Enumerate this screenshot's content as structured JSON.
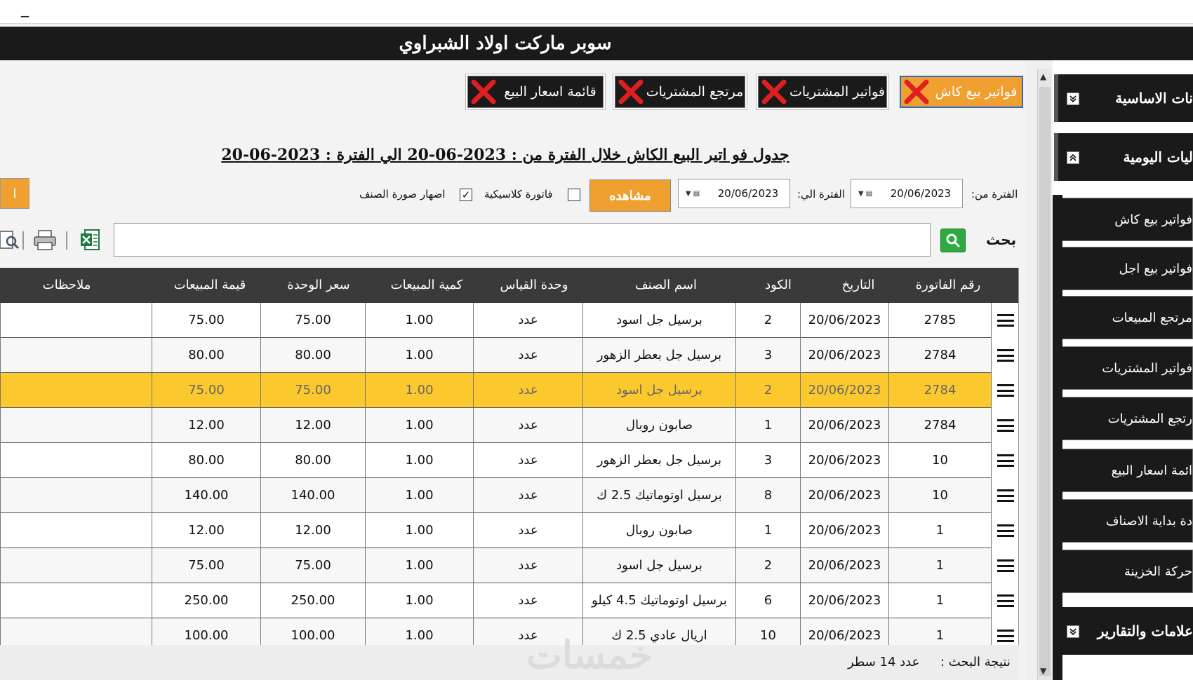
{
  "window": {
    "minimize_label": "_"
  },
  "app_title": "سوبر ماركت اولاد الشبراوي",
  "tabs": [
    {
      "label": "فواتير بيع كاش",
      "active": true
    },
    {
      "label": "فواتير المشتريات",
      "active": false
    },
    {
      "label": "مرتجع المشتريات",
      "active": false
    },
    {
      "label": "قائمة اسعار البيع",
      "active": false
    }
  ],
  "report": {
    "heading": "جدول فو اتير البيع الكاش خلال الفترة من : 2023-06-20 الي الفترة : 2023-06-20"
  },
  "filters": {
    "from_label": "الفترة من:",
    "from_value": "20/06/2023",
    "to_label": "الفترة الي:",
    "to_value": "20/06/2023",
    "view_button": "مشاهده",
    "classic_invoice_label": "فاتورة كلاسيكية",
    "classic_invoice_checked": false,
    "show_image_label": "اضهار صورة الصنف",
    "show_image_checked": true,
    "side_button": "ا"
  },
  "search": {
    "label": "بحث",
    "value": "",
    "placeholder": ""
  },
  "grid": {
    "headers": {
      "invoice_no": "رقم الفاتورة",
      "date": "التاريخ",
      "code": "الكود",
      "item_name": "اسم الصنف",
      "unit": "وحدة القياس",
      "qty": "كمية المبيعات",
      "unit_price": "سعر الوحدة",
      "sales_value": "قيمة المبيعات",
      "notes": "ملاحظات"
    },
    "rows": [
      {
        "invoice_no": "2785",
        "date": "20/06/2023",
        "code": "2",
        "item_name": "برسيل جل اسود",
        "unit": "عدد",
        "qty": "1.00",
        "unit_price": "75.00",
        "sales_value": "75.00",
        "notes": ""
      },
      {
        "invoice_no": "2784",
        "date": "20/06/2023",
        "code": "3",
        "item_name": "برسيل جل بعطر الزهور",
        "unit": "عدد",
        "qty": "1.00",
        "unit_price": "80.00",
        "sales_value": "80.00",
        "notes": ""
      },
      {
        "invoice_no": "2784",
        "date": "20/06/2023",
        "code": "2",
        "item_name": "برسيل جل اسود",
        "unit": "عدد",
        "qty": "1.00",
        "unit_price": "75.00",
        "sales_value": "75.00",
        "notes": "",
        "selected": true
      },
      {
        "invoice_no": "2784",
        "date": "20/06/2023",
        "code": "1",
        "item_name": "صابون روبال",
        "unit": "عدد",
        "qty": "1.00",
        "unit_price": "12.00",
        "sales_value": "12.00",
        "notes": ""
      },
      {
        "invoice_no": "10",
        "date": "20/06/2023",
        "code": "3",
        "item_name": "برسيل جل بعطر الزهور",
        "unit": "عدد",
        "qty": "1.00",
        "unit_price": "80.00",
        "sales_value": "80.00",
        "notes": ""
      },
      {
        "invoice_no": "10",
        "date": "20/06/2023",
        "code": "8",
        "item_name": "برسيل اوتوماتيك 2.5 ك",
        "unit": "عدد",
        "qty": "1.00",
        "unit_price": "140.00",
        "sales_value": "140.00",
        "notes": ""
      },
      {
        "invoice_no": "1",
        "date": "20/06/2023",
        "code": "1",
        "item_name": "صابون روبال",
        "unit": "عدد",
        "qty": "1.00",
        "unit_price": "12.00",
        "sales_value": "12.00",
        "notes": ""
      },
      {
        "invoice_no": "1",
        "date": "20/06/2023",
        "code": "2",
        "item_name": "برسيل جل اسود",
        "unit": "عدد",
        "qty": "1.00",
        "unit_price": "75.00",
        "sales_value": "75.00",
        "notes": ""
      },
      {
        "invoice_no": "1",
        "date": "20/06/2023",
        "code": "6",
        "item_name": "برسيل اوتوماتيك 4.5 كيلو",
        "unit": "عدد",
        "qty": "1.00",
        "unit_price": "250.00",
        "sales_value": "250.00",
        "notes": ""
      },
      {
        "invoice_no": "1",
        "date": "20/06/2023",
        "code": "10",
        "item_name": "اريال عادي 2.5 ك",
        "unit": "عدد",
        "qty": "1.00",
        "unit_price": "100.00",
        "sales_value": "100.00",
        "notes": ""
      }
    ]
  },
  "footer": {
    "result_label": "نتيجة البحث :",
    "result_value": "عدد 14 سطر",
    "watermark": "خمسات"
  },
  "sidebar": {
    "sections": [
      {
        "label": "نات الاساسية",
        "expanded": false
      },
      {
        "label": "ليات اليومية",
        "expanded": true
      },
      {
        "label": "علامات والتقارير",
        "expanded": false
      }
    ],
    "items": [
      {
        "label": "فواتير بيع كاش"
      },
      {
        "label": "فواتير بيع اجل"
      },
      {
        "label": "مرتجع المبيعات"
      },
      {
        "label": "فواتير المشتريات"
      },
      {
        "label": "رتجع المشتريات"
      },
      {
        "label": "ائمة اسعار البيع"
      },
      {
        "label": "دة بداية الاصناف"
      },
      {
        "label": "حركة الخزينة"
      }
    ]
  },
  "colors": {
    "accent_orange": "#f0a030",
    "selected_row": "#fbc92e",
    "title_bar": "#1a1a1a",
    "tab_border_active": "#2a6cc0",
    "close_red": "#e02020",
    "search_green": "#2eaa40"
  },
  "icons": [
    "close-x-icon",
    "calendar-icon",
    "dropdown-arrow-icon",
    "search-icon",
    "print-icon",
    "excel-icon",
    "preview-icon",
    "menu-icon",
    "chevron-expand-icon",
    "chevron-collapse-icon",
    "scroll-up-icon",
    "scroll-down-icon"
  ]
}
